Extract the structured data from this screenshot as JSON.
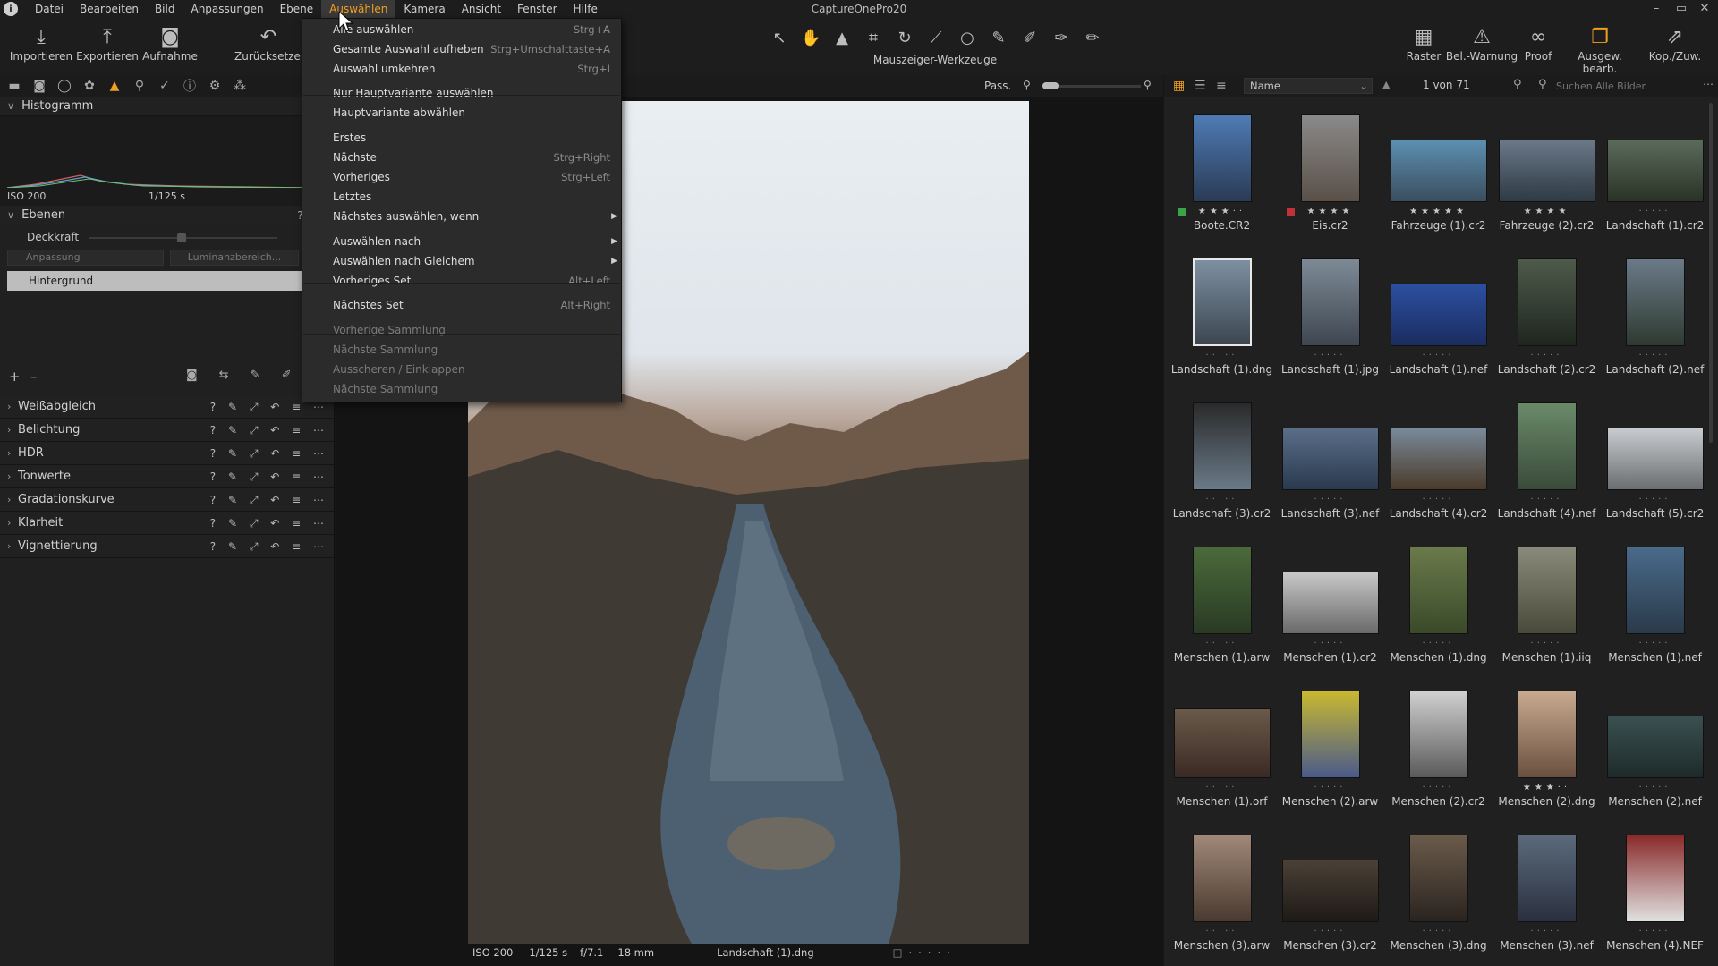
{
  "app_title": "CaptureOnePro20",
  "menubar": {
    "items": [
      "Datei",
      "Bearbeiten",
      "Bild",
      "Anpassungen",
      "Ebene",
      "Auswählen",
      "Kamera",
      "Ansicht",
      "Fenster",
      "Hilfe"
    ],
    "active": "Auswählen"
  },
  "window_controls": [
    "–",
    "▭",
    "✕"
  ],
  "toolbar": {
    "left": [
      "Importieren",
      "Exportieren",
      "Aufnahme",
      "Zurücksetzen"
    ],
    "cursor_tools_label": "Mauszeiger-Werkzeuge",
    "right": [
      "Raster",
      "Bel.-Warnung",
      "Proof",
      "Ausgew. bearb.",
      "Kop./Zuw."
    ]
  },
  "dropdown": {
    "items": [
      {
        "label": "Alle auswählen",
        "shortcut": "Strg+A"
      },
      {
        "label": "Gesamte Auswahl aufheben",
        "shortcut": "Strg+Umschalttaste+A"
      },
      {
        "label": "Auswahl umkehren",
        "shortcut": "Strg+I"
      },
      {
        "label": "Nur Hauptvariante auswählen",
        "shortcut": ""
      },
      {
        "label": "Hauptvariante abwählen",
        "shortcut": ""
      },
      {
        "label": "Erstes",
        "shortcut": ""
      },
      {
        "label": "Nächste",
        "shortcut": "Strg+Right"
      },
      {
        "label": "Vorheriges",
        "shortcut": "Strg+Left"
      },
      {
        "label": "Letztes",
        "shortcut": ""
      },
      {
        "label": "Nächstes auswählen, wenn",
        "shortcut": "",
        "submenu": true
      },
      {
        "label": "Auswählen nach",
        "shortcut": "",
        "submenu": true
      },
      {
        "label": "Auswählen nach Gleichem",
        "shortcut": "",
        "submenu": true
      },
      {
        "label": "Vorheriges Set",
        "shortcut": "Alt+Left"
      },
      {
        "label": "Nächstes Set",
        "shortcut": "Alt+Right"
      },
      {
        "label": "Vorherige Sammlung",
        "shortcut": "",
        "disabled": true
      },
      {
        "label": "Nächste Sammlung",
        "shortcut": "",
        "disabled": true
      },
      {
        "label": "Ausscheren / Einklappen",
        "shortcut": "",
        "disabled": true
      },
      {
        "label": "Nächste Sammlung",
        "shortcut": "",
        "disabled": true
      }
    ]
  },
  "left_panel": {
    "histogram": {
      "title": "Histogramm",
      "iso": "ISO 200",
      "shutter": "1/125 s"
    },
    "layers": {
      "title": "Ebenen",
      "opacity_label": "Deckkraft",
      "adjustment_label": "Anpassung",
      "luminance_label": "Luminanzbereich...",
      "layer_name": "Hintergrund"
    },
    "sections": [
      "Weißabgleich",
      "Belichtung",
      "HDR",
      "Tonwerte",
      "Gradationskurve",
      "Klarheit",
      "Vignettierung"
    ]
  },
  "viewer": {
    "fit_label": "Pass.",
    "footer": {
      "iso": "ISO 200",
      "shutter": "1/125 s",
      "aperture": "f/7.1",
      "focal": "18 mm",
      "filename": "Landschaft (1).dng"
    }
  },
  "browser": {
    "sort_label": "Name",
    "count": "1 von 71",
    "search_placeholder": "Suchen Alle Bilder",
    "thumbs": [
      {
        "name": "Boote.CR2",
        "rating": "★★★··",
        "tag": "green"
      },
      {
        "name": "Eis.cr2",
        "rating": "★★★★",
        "tag": "red"
      },
      {
        "name": "Fahrzeuge (1).cr2",
        "rating": "★★★★★"
      },
      {
        "name": "Fahrzeuge (2).cr2",
        "rating": "★★★★"
      },
      {
        "name": "Landschaft (1).cr2",
        "rating": "·····"
      },
      {
        "name": "Landschaft (1).dng",
        "rating": "·····"
      },
      {
        "name": "Landschaft (1).jpg",
        "rating": "·····"
      },
      {
        "name": "Landschaft (1).nef",
        "rating": "·····"
      },
      {
        "name": "Landschaft (2).cr2",
        "rating": "·····"
      },
      {
        "name": "Landschaft (2).nef",
        "rating": "·····"
      },
      {
        "name": "Landschaft (3).cr2",
        "rating": "·····"
      },
      {
        "name": "Landschaft (3).nef",
        "rating": "·····"
      },
      {
        "name": "Landschaft (4).cr2",
        "rating": "·····"
      },
      {
        "name": "Landschaft (4).nef",
        "rating": "·····"
      },
      {
        "name": "Landschaft (5).cr2",
        "rating": "·····"
      },
      {
        "name": "Menschen (1).arw",
        "rating": "·····"
      },
      {
        "name": "Menschen (1).cr2",
        "rating": "·····"
      },
      {
        "name": "Menschen (1).dng",
        "rating": "·····"
      },
      {
        "name": "Menschen (1).iiq",
        "rating": "·····"
      },
      {
        "name": "Menschen (1).nef",
        "rating": "·····"
      },
      {
        "name": "Menschen (1).orf",
        "rating": "·····"
      },
      {
        "name": "Menschen (2).arw",
        "rating": "·····"
      },
      {
        "name": "Menschen (2).cr2",
        "rating": "·····"
      },
      {
        "name": "Menschen (2).dng",
        "rating": "★★★··"
      },
      {
        "name": "Menschen (2).nef",
        "rating": "·····"
      },
      {
        "name": "Menschen (3).arw",
        "rating": "·····"
      },
      {
        "name": "Menschen (3).cr2",
        "rating": "·····"
      },
      {
        "name": "Menschen (3).dng",
        "rating": "·····"
      },
      {
        "name": "Menschen (3).nef",
        "rating": "·····"
      },
      {
        "name": "Menschen (4).NEF",
        "rating": "·····"
      }
    ]
  },
  "colors": {
    "accent": "#f0a020",
    "tag_green": "#3aa34a",
    "tag_red": "#c0323a"
  }
}
